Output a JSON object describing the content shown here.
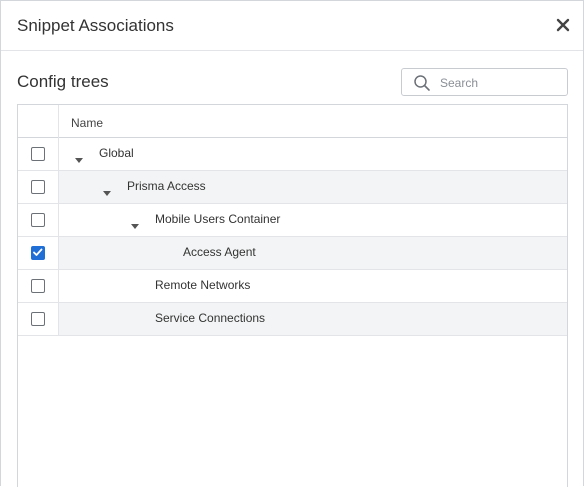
{
  "dialog": {
    "title": "Snippet Associations",
    "close_icon": "close-icon"
  },
  "section": {
    "title": "Config trees"
  },
  "search": {
    "placeholder": "Search",
    "value": "",
    "icon": "search-icon"
  },
  "grid": {
    "columns": [
      "Name"
    ],
    "rows": [
      {
        "label": "Global",
        "level": 0,
        "expandable": true,
        "expanded": true,
        "checked": false
      },
      {
        "label": "Prisma Access",
        "level": 1,
        "expandable": true,
        "expanded": true,
        "checked": false
      },
      {
        "label": "Mobile Users Container",
        "level": 2,
        "expandable": true,
        "expanded": true,
        "checked": false
      },
      {
        "label": "Access Agent",
        "level": 3,
        "expandable": false,
        "checked": true
      },
      {
        "label": "Remote Networks",
        "level": 2,
        "expandable": false,
        "checked": false
      },
      {
        "label": "Service Connections",
        "level": 2,
        "expandable": false,
        "checked": false
      }
    ]
  },
  "colors": {
    "checked_fill": "#1f6fd6",
    "row_shade": "#f3f4f5",
    "border": "#d3d6da"
  }
}
